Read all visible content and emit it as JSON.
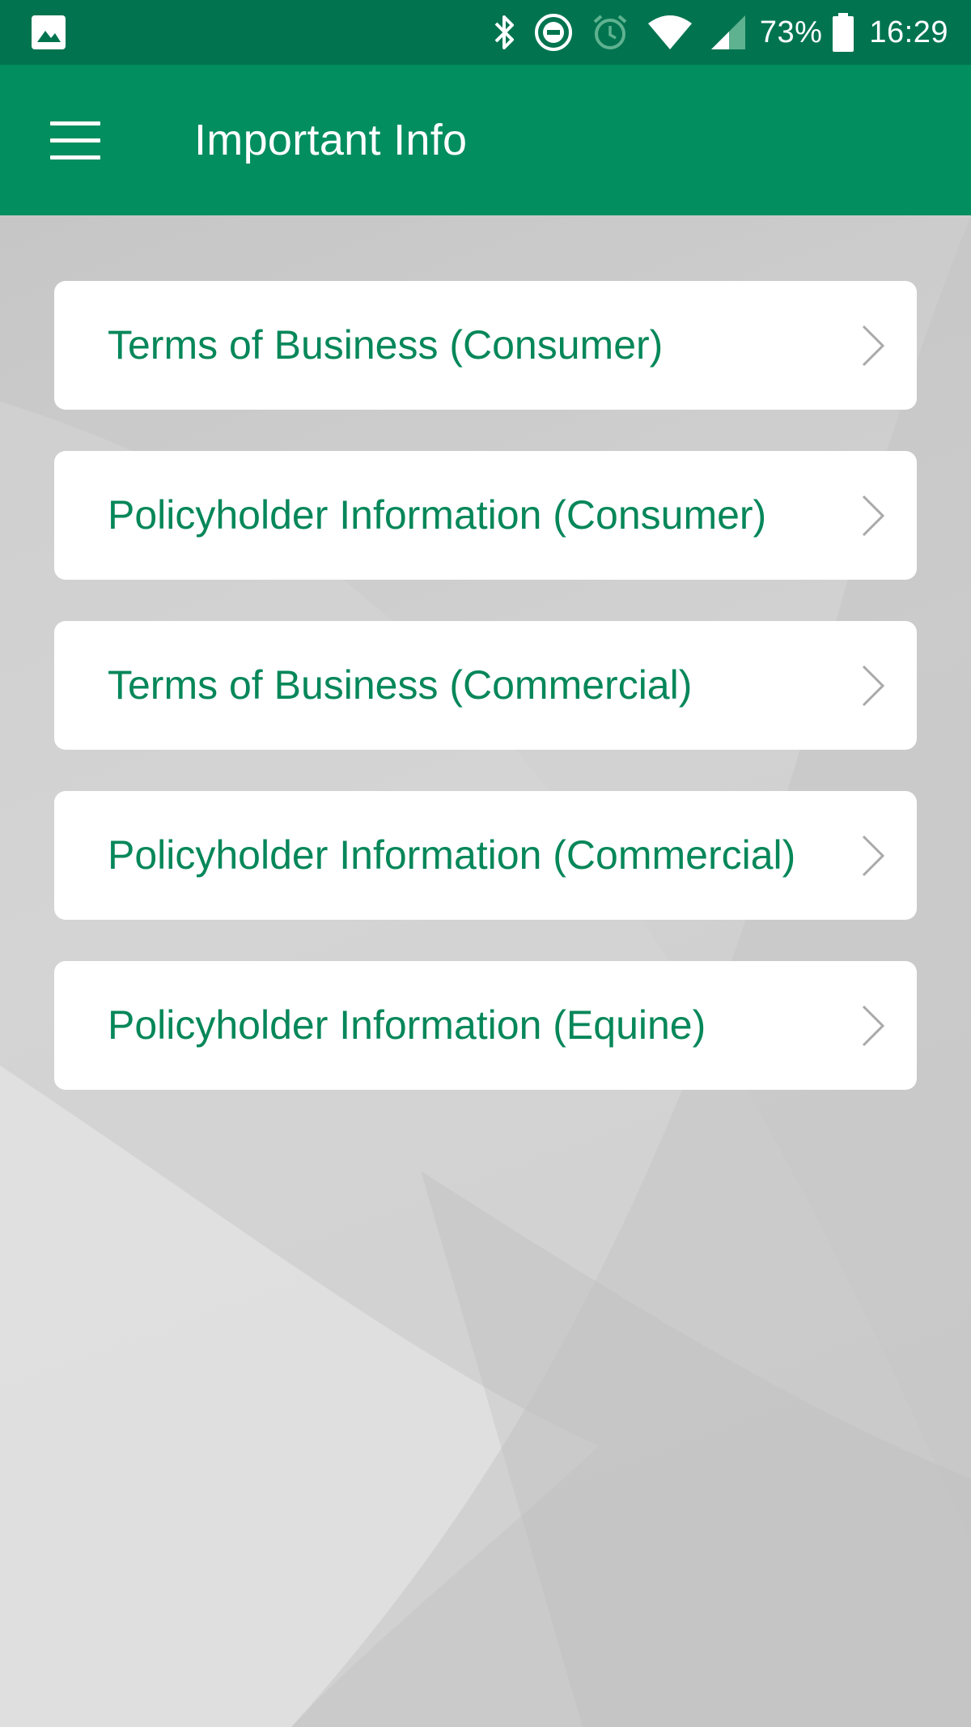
{
  "status_bar": {
    "icons": [
      "gallery-icon",
      "bluetooth-icon",
      "do-not-disturb-icon",
      "alarm-icon",
      "wifi-icon",
      "cell-signal-icon",
      "battery-icon"
    ],
    "battery_percent": "73%",
    "time": "16:29"
  },
  "app_bar": {
    "title": "Important Info",
    "menu_icon": "hamburger-menu-icon"
  },
  "colors": {
    "status_bar": "#01744f",
    "app_bar": "#028e5f",
    "accent_text": "#06875a",
    "card": "#ffffff",
    "background": "#cfcfcf"
  },
  "menu": {
    "items": [
      {
        "label": "Terms of Business (Consumer)"
      },
      {
        "label": "Policyholder Information (Consumer)"
      },
      {
        "label": "Terms of Business (Commercial)"
      },
      {
        "label": "Policyholder Information (Commercial)"
      },
      {
        "label": "Policyholder Information (Equine)"
      }
    ],
    "item_icon": "chevron-right-icon"
  }
}
